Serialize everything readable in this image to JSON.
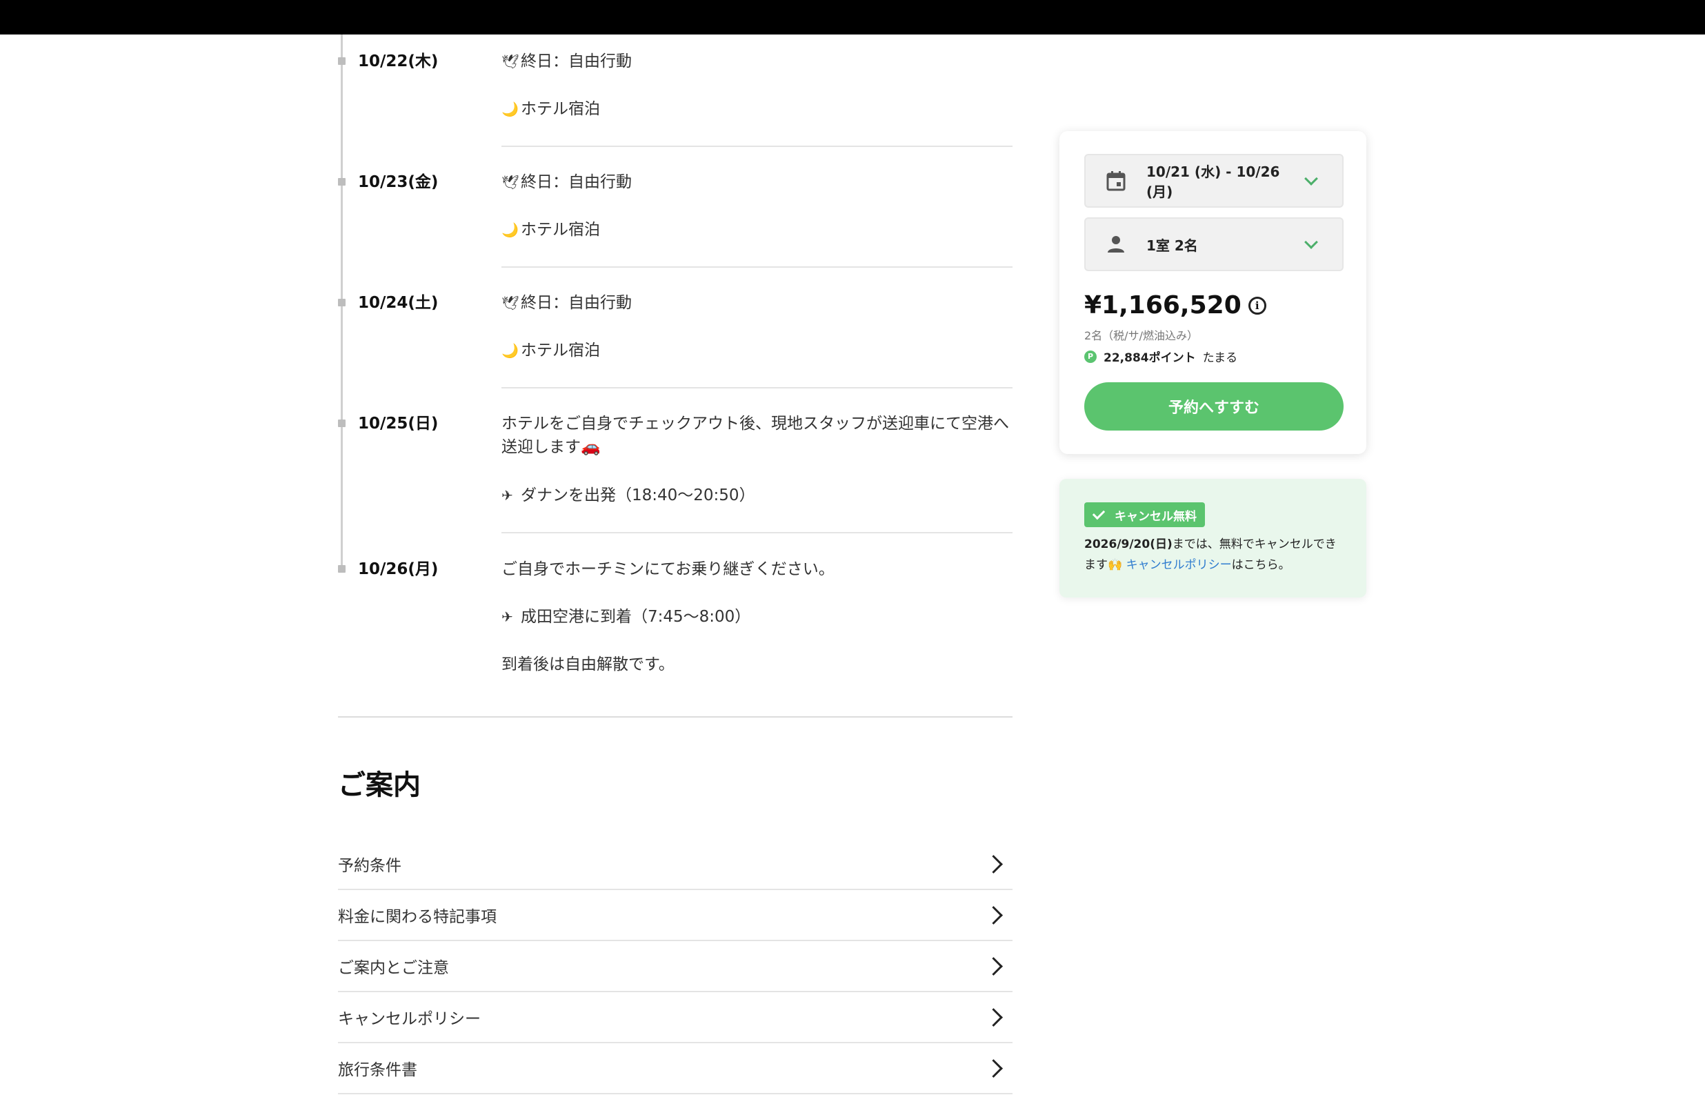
{
  "itinerary": [
    {
      "date": "10/22(木)",
      "entries": [
        {
          "icon": "🕊",
          "icon_name": "dove-icon",
          "text": "終日：自由行動"
        },
        {
          "icon": "🌙",
          "icon_name": "moon-icon",
          "text": "ホテル宿泊"
        }
      ]
    },
    {
      "date": "10/23(金)",
      "entries": [
        {
          "icon": "🕊",
          "icon_name": "dove-icon",
          "text": "終日：自由行動"
        },
        {
          "icon": "🌙",
          "icon_name": "moon-icon",
          "text": "ホテル宿泊"
        }
      ]
    },
    {
      "date": "10/24(土)",
      "entries": [
        {
          "icon": "🕊",
          "icon_name": "dove-icon",
          "text": "終日：自由行動"
        },
        {
          "icon": "🌙",
          "icon_name": "moon-icon",
          "text": "ホテル宿泊"
        }
      ]
    },
    {
      "date": "10/25(日)",
      "entries": [
        {
          "icon": "",
          "text": "ホテルをご自身でチェックアウト後、現地スタッフが送迎車にて空港へ送迎します🚗"
        },
        {
          "icon": "✈",
          "icon_name": "airplane-icon",
          "text": "ダナンを出発（18:40〜20:50）"
        }
      ]
    },
    {
      "date": "10/26(月)",
      "entries": [
        {
          "icon": "",
          "text": "ご自身でホーチミンにてお乗り継ぎください。"
        },
        {
          "icon": "✈",
          "icon_name": "airplane-icon",
          "text": "成田空港に到着（7:45〜8:00）"
        },
        {
          "icon": "",
          "text": "到着後は自由解散です。"
        }
      ]
    }
  ],
  "info": {
    "title": "ご案内",
    "rows": [
      "予約条件",
      "料金に関わる特記事項",
      "ご案内とご注意",
      "キャンセルポリシー",
      "旅行条件書"
    ]
  },
  "booking": {
    "dates": "10/21 (水) - 10/26 (月)",
    "guests": "1室 2名",
    "price": "¥1,166,520",
    "info_icon": "i",
    "price_note": "2名（税/サ/燃油込み）",
    "points_badge": "P",
    "points": "22,884ポイント",
    "points_suffix": "たまる",
    "reserve_label": "予約へすすむ"
  },
  "cancel": {
    "badge": "キャンセル無料",
    "deadline": "2026/9/20(日)",
    "text_after_deadline": "までは、無料でキャンセルできます🙌 ",
    "policy_link": "キャンセルポリシー",
    "text_end": "はこちら。"
  },
  "colors": {
    "accent": "#5bc46e",
    "link": "#2f7ccf",
    "cancel_bg": "#e9f7ec"
  }
}
